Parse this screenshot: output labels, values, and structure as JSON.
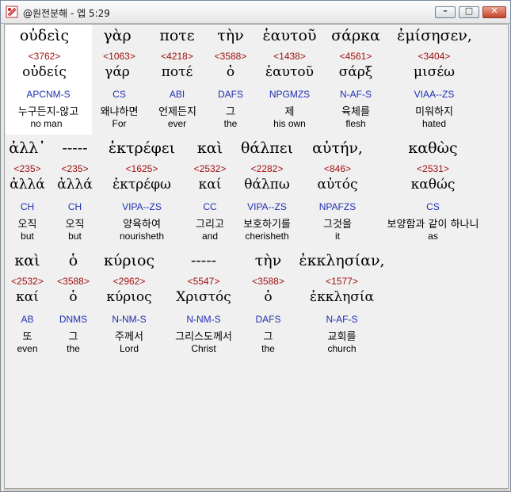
{
  "window": {
    "title": "@원전분해 - 엡 5:29",
    "buttons": {
      "minimize": "–",
      "maximize": "□",
      "close": "✕"
    }
  },
  "rows": [
    {
      "words": [
        {
          "greek": "οὐδεὶς",
          "strong": "<3762>",
          "lemma": "οὐδείς",
          "morph": "APCNM-S",
          "korean": "누구든지-않고",
          "english": "no man"
        },
        {
          "greek": "γὰρ",
          "strong": "<1063>",
          "lemma": "γάρ",
          "morph": "CS",
          "korean": "왜냐하면",
          "english": "For"
        },
        {
          "greek": "ποτε",
          "strong": "<4218>",
          "lemma": "ποτέ",
          "morph": "ABI",
          "korean": "언제든지",
          "english": "ever"
        },
        {
          "greek": "τὴν",
          "strong": "<3588>",
          "lemma": "ὁ",
          "morph": "DAFS",
          "korean": "그",
          "english": "the"
        },
        {
          "greek": "ἑαυτοῦ",
          "strong": "<1438>",
          "lemma": "ἑαυτοῦ",
          "morph": "NPGMZS",
          "korean": "제",
          "english": "his own"
        },
        {
          "greek": "σάρκα",
          "strong": "<4561>",
          "lemma": "σάρξ",
          "morph": "N-AF-S",
          "korean": "육체를",
          "english": "flesh"
        },
        {
          "greek": "ἐμίσησεν,",
          "strong": "<3404>",
          "lemma": "μισέω",
          "morph": "VIAA--ZS",
          "korean": "미워하지",
          "english": "hated"
        }
      ]
    },
    {
      "words": [
        {
          "greek": "ἀλλ᾽",
          "strong": "<235>",
          "lemma": "ἀλλά",
          "morph": "CH",
          "korean": "오직",
          "english": "but"
        },
        {
          "greek": "-----",
          "strong": "<235>",
          "lemma": "ἀλλά",
          "morph": "CH",
          "korean": "오직",
          "english": "but"
        },
        {
          "greek": "ἐκτρέφει",
          "strong": "<1625>",
          "lemma": "ἐκτρέφω",
          "morph": "VIPA--ZS",
          "korean": "양육하여",
          "english": "nourisheth"
        },
        {
          "greek": "καὶ",
          "strong": "<2532>",
          "lemma": "καί",
          "morph": "CC",
          "korean": "그리고",
          "english": "and"
        },
        {
          "greek": "θάλπει",
          "strong": "<2282>",
          "lemma": "θάλπω",
          "morph": "VIPA--ZS",
          "korean": "보호하기를",
          "english": "cherisheth"
        },
        {
          "greek": "αὐτήν,",
          "strong": "<846>",
          "lemma": "αὐτός",
          "morph": "NPAFZS",
          "korean": "그것을",
          "english": "it"
        },
        {
          "greek": "καθὼς",
          "strong": "<2531>",
          "lemma": "καθώς",
          "morph": "CS",
          "korean": "보양함과 같이 하나니",
          "english": "as"
        }
      ]
    },
    {
      "words": [
        {
          "greek": "καὶ",
          "strong": "<2532>",
          "lemma": "καί",
          "morph": "AB",
          "korean": "또",
          "english": "even"
        },
        {
          "greek": "ὁ",
          "strong": "<3588>",
          "lemma": "ὁ",
          "morph": "DNMS",
          "korean": "그",
          "english": "the"
        },
        {
          "greek": "κύριος",
          "strong": "<2962>",
          "lemma": "κύριος",
          "morph": "N-NM-S",
          "korean": "주께서",
          "english": "Lord"
        },
        {
          "greek": "-----",
          "strong": "<5547>",
          "lemma": "Χριστός",
          "morph": "N-NM-S",
          "korean": "그리스도께서",
          "english": "Christ"
        },
        {
          "greek": "τὴν",
          "strong": "<3588>",
          "lemma": "ὁ",
          "morph": "DAFS",
          "korean": "그",
          "english": "the"
        },
        {
          "greek": "ἐκκλησίαν,",
          "strong": "<1577>",
          "lemma": "ἐκκλησία",
          "morph": "N-AF-S",
          "korean": "교회를",
          "english": "church"
        }
      ]
    }
  ]
}
